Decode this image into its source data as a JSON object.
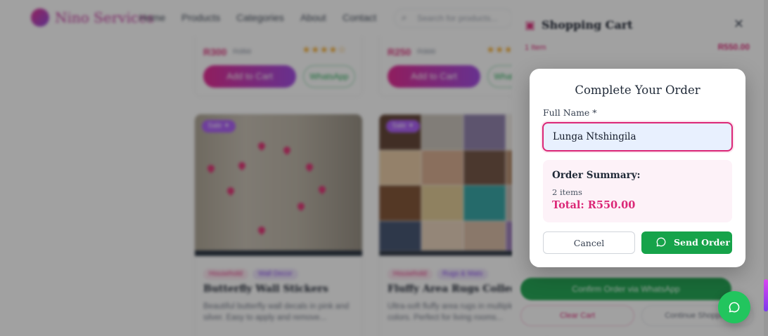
{
  "nav": {
    "brand": "Nino Services",
    "links": [
      "Home",
      "Products",
      "Categories",
      "About",
      "Contact"
    ],
    "search_placeholder": "Search for products..."
  },
  "top_cards": [
    {
      "price": "R300",
      "old_price": "R350",
      "stars": "★★★★☆",
      "add_label": "Add to Cart",
      "wa_label": "WhatsApp"
    },
    {
      "price": "R250",
      "old_price": "R300",
      "stars": "★★★★☆",
      "add_label": "Add to Cart",
      "wa_label": "WhatsApp"
    }
  ],
  "products": [
    {
      "badge": "Sale ✦",
      "tags": [
        "Household",
        "Wall Decor"
      ],
      "title": "Butterfly Wall Stickers",
      "desc": "Beautiful butterfly wall decals in pink and silver. Easy to apply and remove..."
    },
    {
      "badge": "Sale ✦",
      "tags": [
        "Household",
        "Rugs & Mats"
      ],
      "title": "Fluffy Area Rugs Collection",
      "desc": "Ultra-soft fluffy area rugs in multiple colors. Perfect for living rooms..."
    }
  ],
  "cart": {
    "title": "Shopping Cart",
    "row_label": "1 Item",
    "row_price": "R550.00",
    "confirm_label": "Confirm Order via WhatsApp",
    "clear_label": "Clear Cart",
    "continue_label": "Continue Shopping"
  },
  "modal": {
    "title": "Complete Your Order",
    "name_label": "Full Name *",
    "name_value": "Lunga Ntshingila",
    "summary_title": "Order Summary:",
    "summary_items": "2 items",
    "summary_total": "Total: R550.00",
    "cancel_label": "Cancel",
    "send_label": "Send Order"
  },
  "colors": {
    "accent": "#db2777",
    "whatsapp": "#16a34a",
    "fab": "#22c55e",
    "input_bg": "#e8f0fe",
    "summary_bg": "#fdf2f8"
  },
  "icons": {
    "send": "chat-bubble-icon",
    "fab": "whatsapp-chat-icon",
    "cart": "shopping-bag-icon",
    "close": "close-icon",
    "search": "search-icon"
  }
}
